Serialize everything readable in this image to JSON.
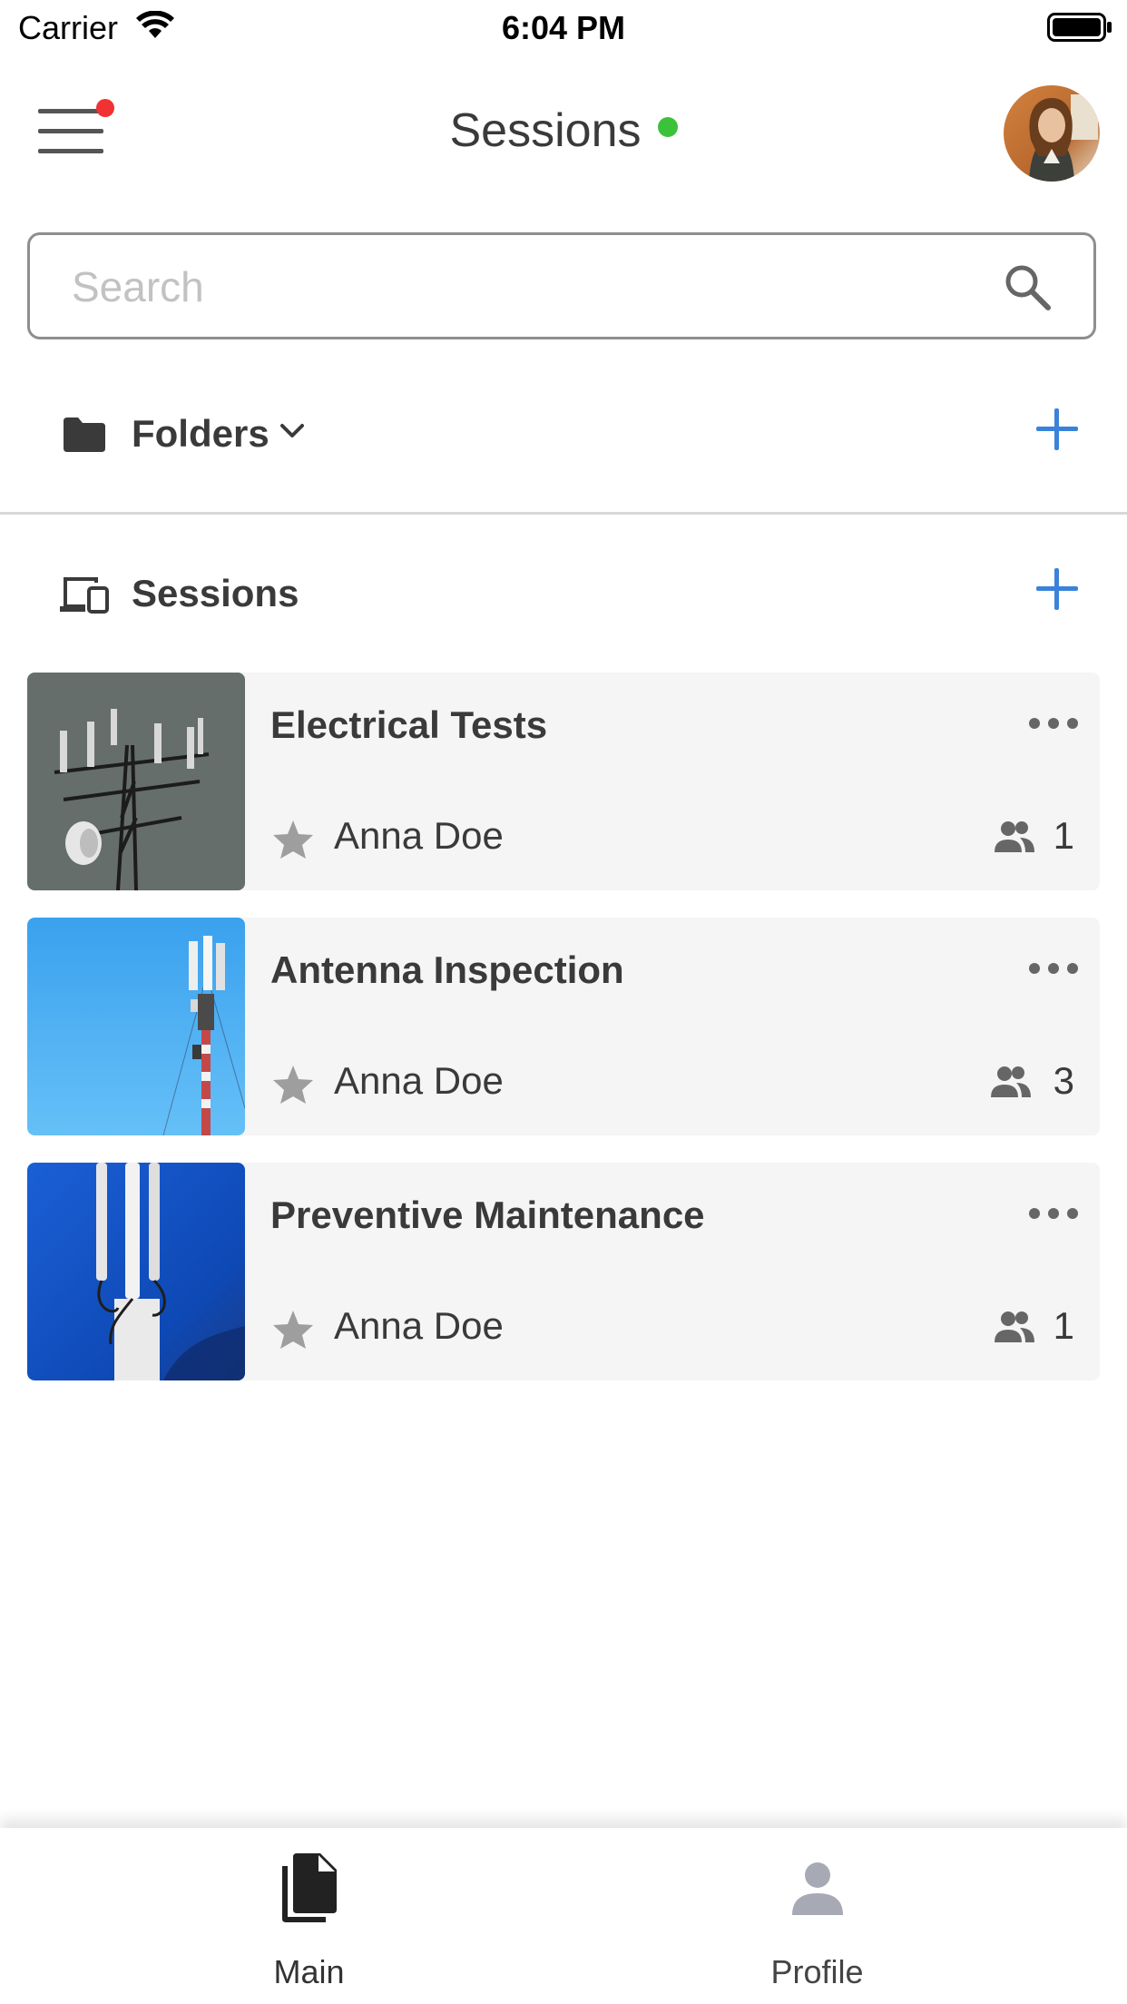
{
  "status_bar": {
    "carrier": "Carrier",
    "time": "6:04 PM"
  },
  "header": {
    "title": "Sessions",
    "online_color": "#3cc13b",
    "notification_color": "#f03232"
  },
  "search": {
    "placeholder": "Search"
  },
  "folders": {
    "label": "Folders",
    "add_color": "#3a82d9"
  },
  "sessions": {
    "label": "Sessions",
    "items": [
      {
        "title": "Electrical Tests",
        "owner": "Anna Doe",
        "participants": "1",
        "thumbnail": "tower-gray-icon"
      },
      {
        "title": "Antenna Inspection",
        "owner": "Anna Doe",
        "participants": "3",
        "thumbnail": "tower-sky-icon"
      },
      {
        "title": "Preventive Maintenance",
        "owner": "Anna Doe",
        "participants": "1",
        "thumbnail": "antenna-blue-icon"
      }
    ]
  },
  "tabbar": {
    "tabs": [
      {
        "label": "Main",
        "icon": "document-icon",
        "active": true
      },
      {
        "label": "Profile",
        "icon": "person-icon",
        "active": false
      }
    ]
  }
}
